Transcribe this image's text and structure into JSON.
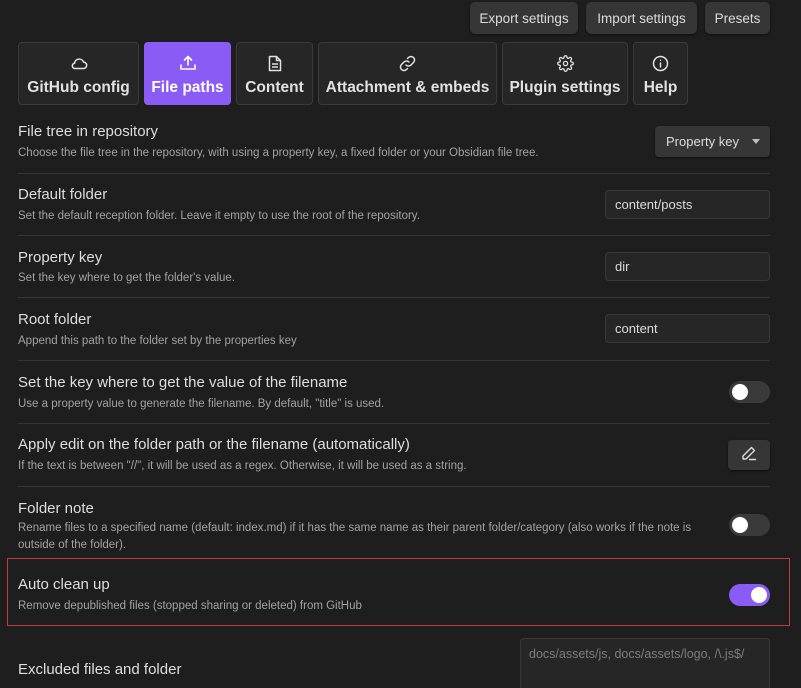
{
  "top_buttons": {
    "export": "Export settings",
    "import": "Import settings",
    "presets": "Presets"
  },
  "tabs": [
    {
      "label": "GitHub config",
      "icon": "cloud-icon",
      "active": false
    },
    {
      "label": "File paths",
      "icon": "upload-icon",
      "active": true
    },
    {
      "label": "Content",
      "icon": "file-text-icon",
      "active": false
    },
    {
      "label": "Attachment & embeds",
      "icon": "link-icon",
      "active": false
    },
    {
      "label": "Plugin settings",
      "icon": "gear-icon",
      "active": false
    },
    {
      "label": "Help",
      "icon": "info-icon",
      "active": false
    }
  ],
  "settings": {
    "file_tree": {
      "name": "File tree in repository",
      "desc": "Choose the file tree in the repository, with using a property key, a fixed folder or your Obsidian file tree.",
      "value": "Property key"
    },
    "default_folder": {
      "name": "Default folder",
      "desc": "Set the default reception folder. Leave it empty to use the root of the repository.",
      "value": "content/posts"
    },
    "property_key": {
      "name": "Property key",
      "desc": "Set the key where to get the folder's value.",
      "value": "dir"
    },
    "root_folder": {
      "name": "Root folder",
      "desc": "Append this path to the folder set by the properties key",
      "value": "content"
    },
    "filename_key": {
      "name": "Set the key where to get the value of the filename",
      "desc": "Use a property value to generate the filename. By default, \"title\" is used.",
      "enabled": false
    },
    "apply_edit": {
      "name": "Apply edit on the folder path or the filename (automatically)",
      "desc": "If the text is between \"//\", it will be used as a regex. Otherwise, it will be used as a string.",
      "button_icon": "pencil-icon"
    },
    "folder_note": {
      "name": "Folder note",
      "desc": "Rename files to a specified name (default: index.md) if it has the same name as their parent folder/category (also works if the note is outside of the folder).",
      "enabled": false
    },
    "auto_clean": {
      "name": "Auto clean up",
      "desc": "Remove depublished files (stopped sharing or deleted) from GitHub",
      "enabled": true
    },
    "excluded": {
      "name": "Excluded files and folder",
      "placeholder": "docs/assets/js, docs/assets/logo, /\\.js$/"
    }
  },
  "colors": {
    "accent": "#8a5cf5",
    "background": "#1e1e1e",
    "highlight_border": "#c83a3a"
  }
}
